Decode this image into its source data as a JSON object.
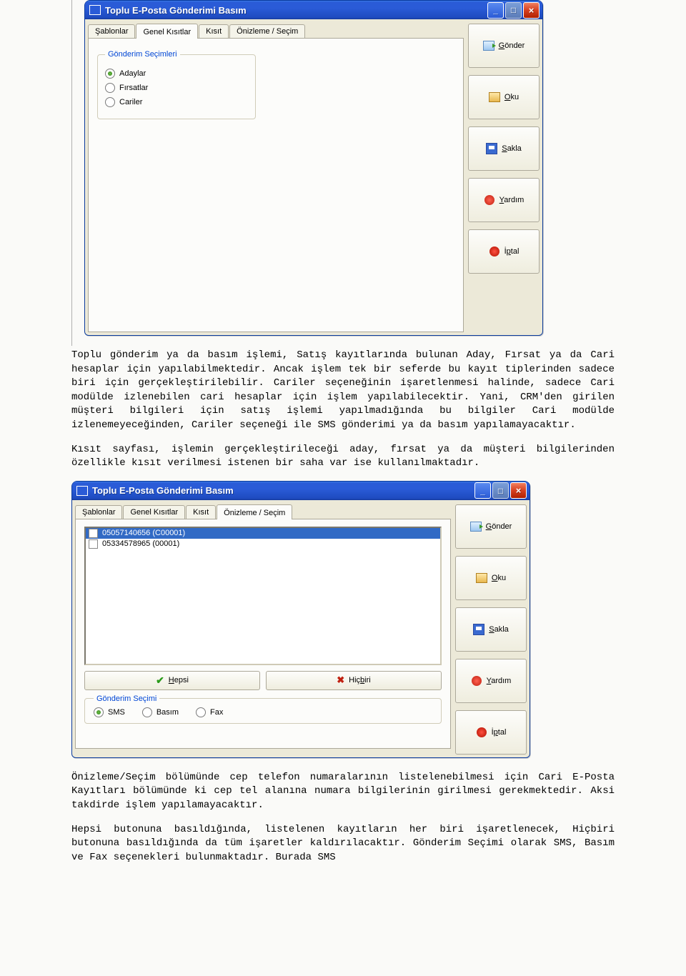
{
  "window1": {
    "title": "Toplu E-Posta Gönderimi  Basım",
    "tabs": [
      "Şablonlar",
      "Genel Kısıtlar",
      "Kısıt",
      "Önizleme / Seçim"
    ],
    "active_tab_index": 1,
    "groupbox_title": "Gönderim Seçimleri",
    "radios": [
      "Adaylar",
      "Fırsatlar",
      "Cariler"
    ],
    "radio_selected_index": 0
  },
  "side_buttons": {
    "send": "Gönder",
    "read": "Oku",
    "save": "Sakla",
    "help": "Yardım",
    "cancel": "İptal"
  },
  "para1": "Toplu gönderim ya da basım işlemi, Satış kayıtlarında bulunan Aday, Fırsat ya da Cari hesaplar için yapılabilmektedir. Ancak işlem tek bir seferde bu kayıt tiplerinden sadece biri için gerçekleştirilebilir. Cariler seçeneğinin işaretlenmesi halinde, sadece Cari modülde izlenebilen cari hesaplar için işlem yapılabilecektir. Yani, CRM'den girilen müşteri bilgileri için satış işlemi yapılmadığında bu bilgiler Cari modülde izlenemeyeceğinden, Cariler seçeneği ile SMS gönderimi ya da basım yapılamayacaktır.",
  "para2": "Kısıt sayfası, işlemin gerçekleştirileceği aday, fırsat ya da müşteri bilgilerinden özellikle kısıt verilmesi istenen bir saha var ise kullanılmaktadır.",
  "window2": {
    "title": "Toplu E-Posta Gönderimi  Basım",
    "tabs": [
      "Şablonlar",
      "Genel Kısıtlar",
      "Kısıt",
      "Önizleme / Seçim"
    ],
    "active_tab_index": 3,
    "list_items": [
      {
        "label": "05057140656 (C00001)",
        "selected": true
      },
      {
        "label": "05334578965 (00001)",
        "selected": false
      }
    ],
    "btn_all": "Hepsi",
    "btn_none": "Hiçbiri",
    "groupbox_title": "Gönderim Seçimi",
    "radios": [
      "SMS",
      "Basım",
      "Fax"
    ],
    "radio_selected_index": 0
  },
  "para3": "Önizleme/Seçim bölümünde cep telefon numaralarının listelenebilmesi için Cari E-Posta Kayıtları bölümünde ki cep tel alanına numara bilgilerinin girilmesi gerekmektedir. Aksi takdirde işlem yapılamayacaktır.",
  "para4": "Hepsi butonuna basıldığında, listelenen kayıtların her biri işaretlenecek, Hiçbiri butonuna basıldığında da tüm işaretler kaldırılacaktır. Gönderim Seçimi olarak SMS, Basım ve Fax seçenekleri bulunmaktadır. Burada SMS"
}
